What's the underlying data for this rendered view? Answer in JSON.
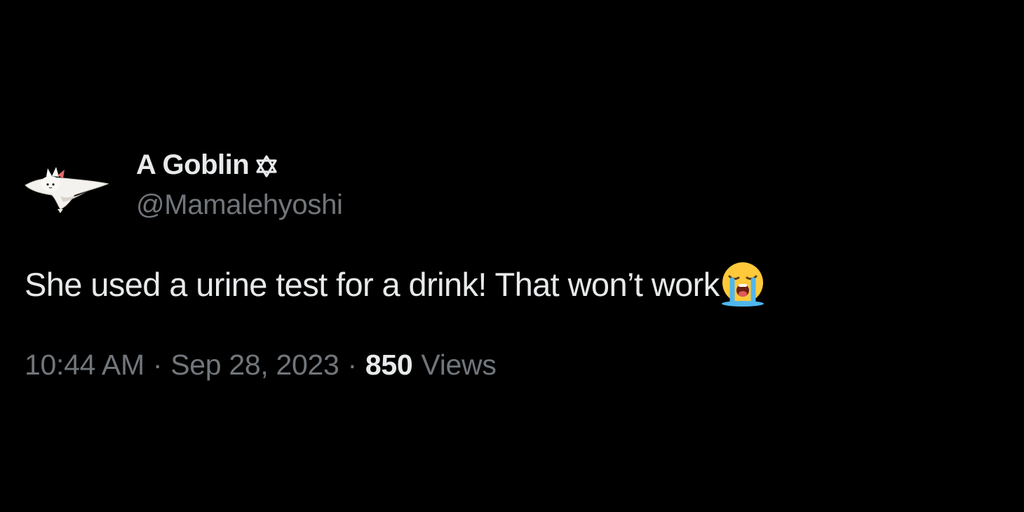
{
  "author": {
    "display_name": "A Goblin",
    "handle": "@Mamalehyoshi",
    "name_badge_icon": "star-of-david-icon",
    "avatar_icon": "pokemon-avatar-icon"
  },
  "tweet": {
    "text": "She used a urine test for a drink! That won’t work",
    "emoji_icon": "loudly-crying-face-icon"
  },
  "meta": {
    "time": "10:44 AM",
    "separator": "·",
    "date": "Sep 28, 2023",
    "views_count": "850",
    "views_label": "Views"
  },
  "colors": {
    "background": "#000000",
    "primary_text": "#e7e9ea",
    "secondary_text": "#71767b"
  }
}
